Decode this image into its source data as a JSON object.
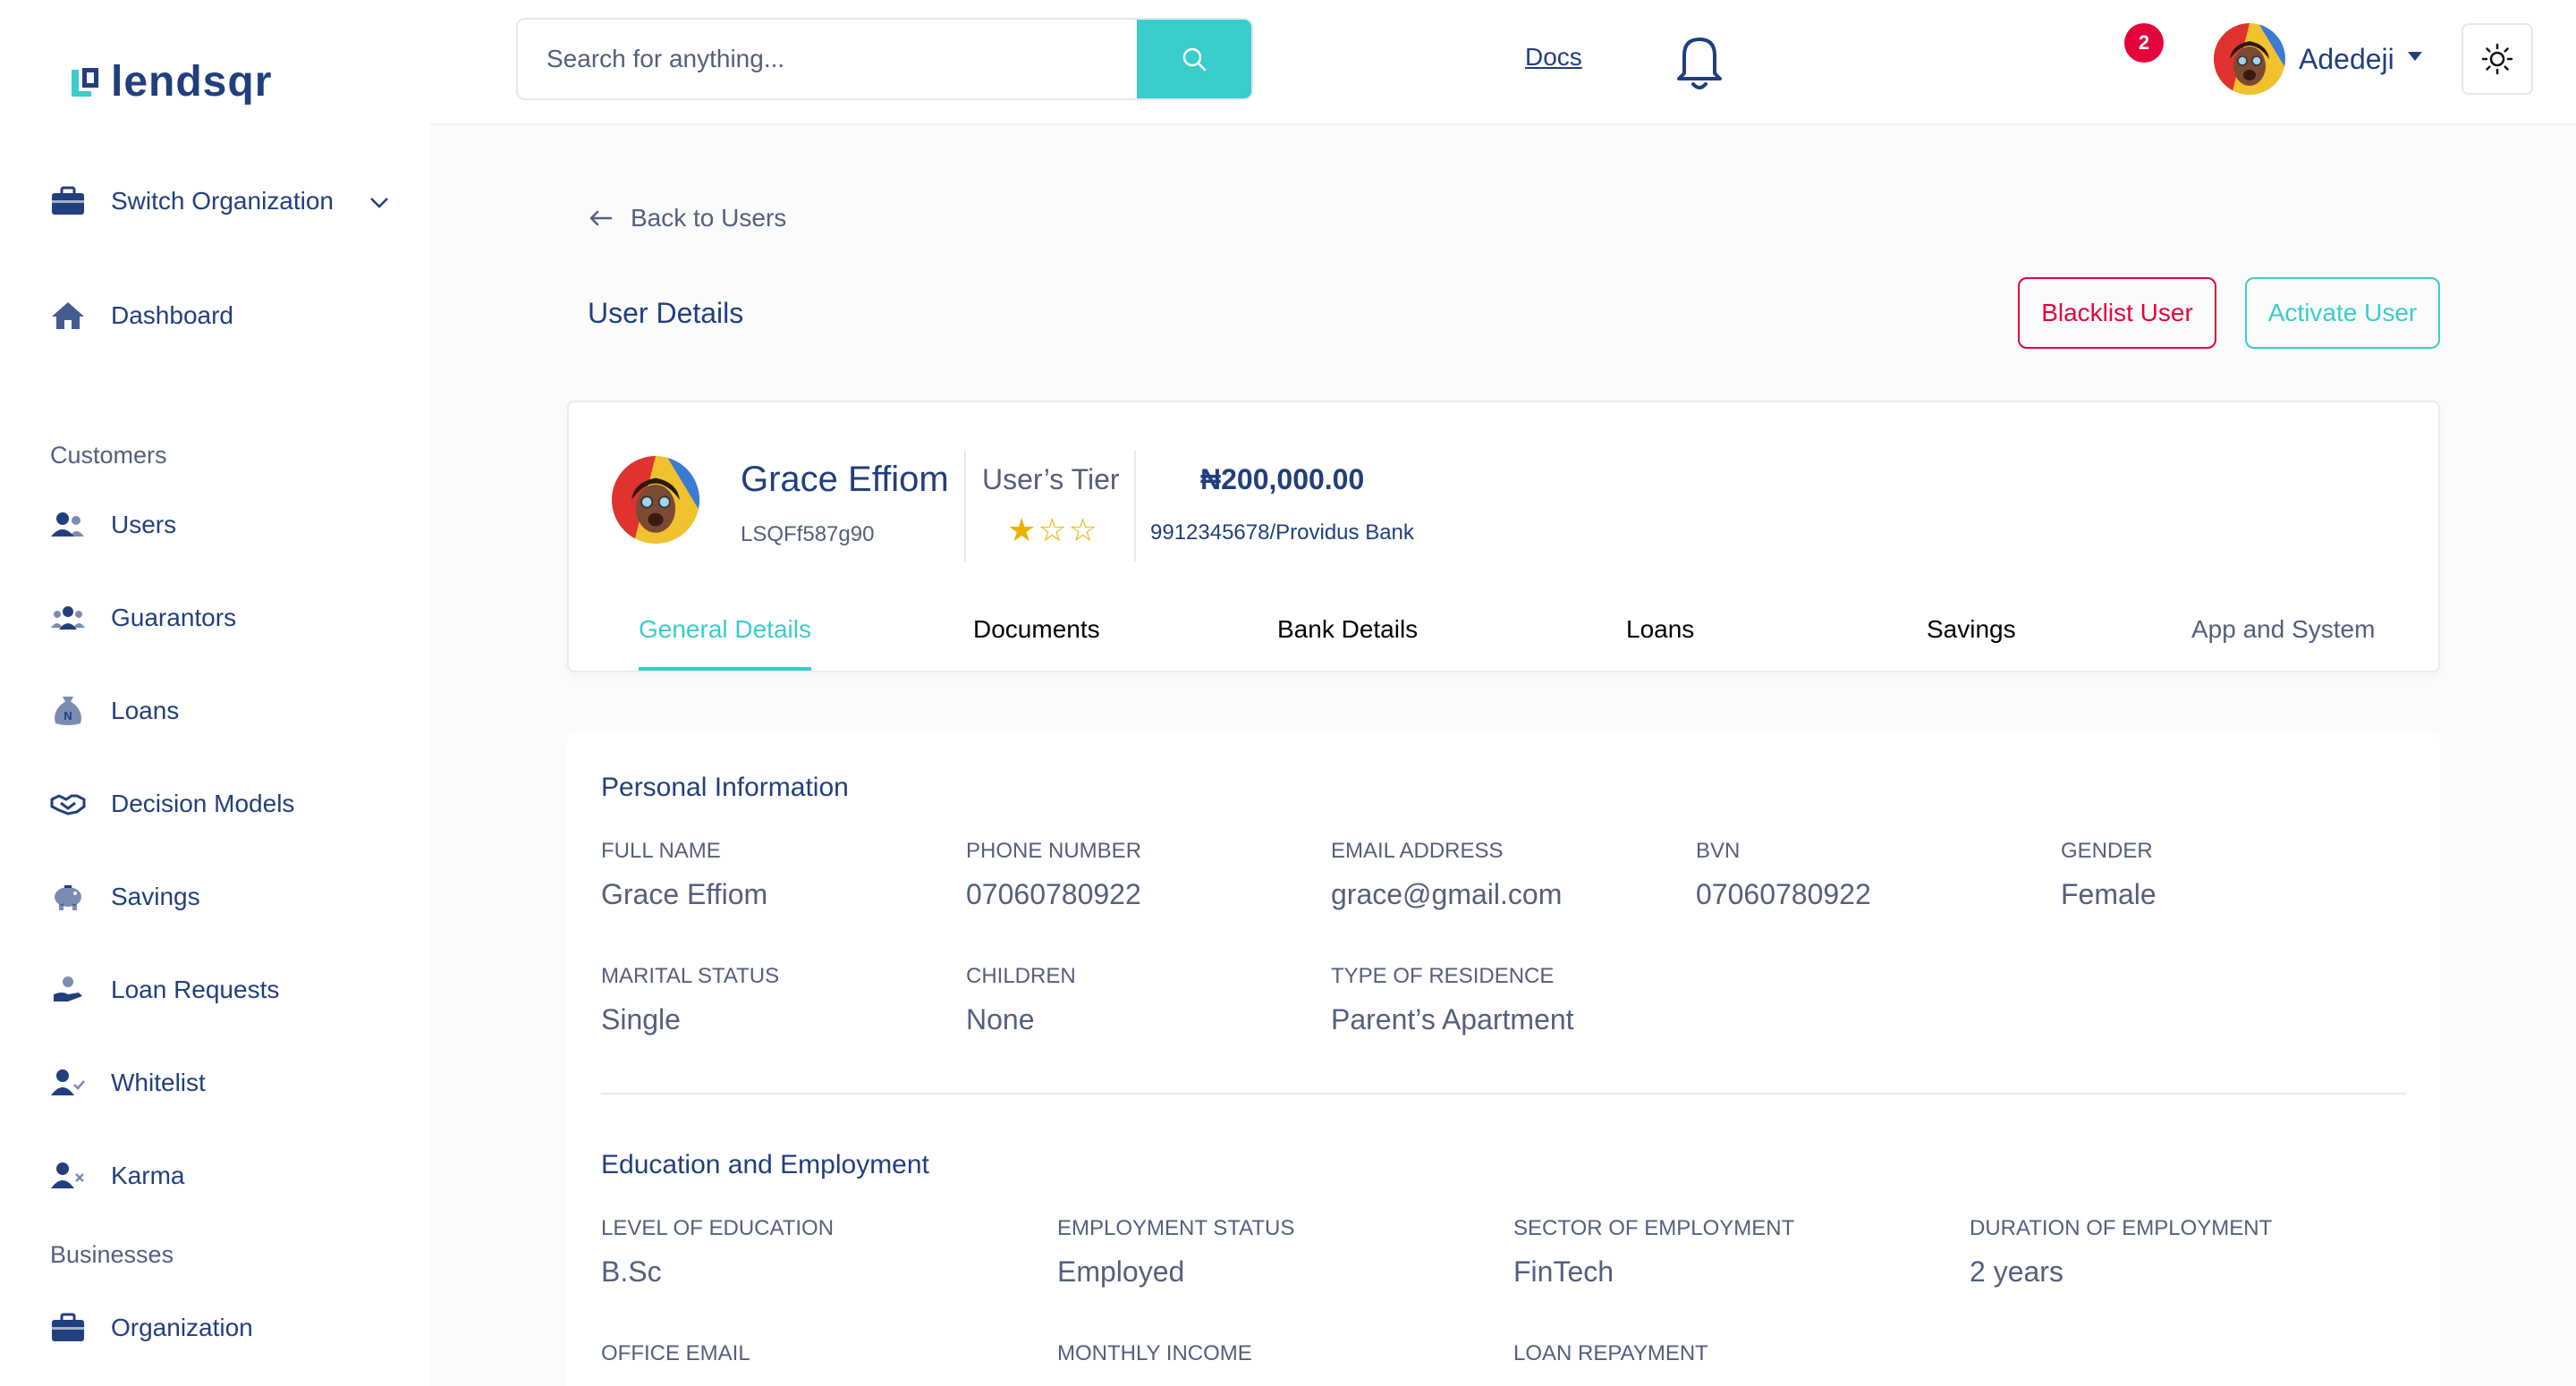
{
  "brand": {
    "name": "lendsqr"
  },
  "sidebar": {
    "switch_org": "Switch Organization",
    "dashboard": "Dashboard",
    "sections": {
      "customers": "Customers",
      "businesses": "Businesses"
    },
    "customers": [
      {
        "label": "Users",
        "icon": "users-icon"
      },
      {
        "label": "Guarantors",
        "icon": "guarantors-icon"
      },
      {
        "label": "Loans",
        "icon": "loan-sack-icon"
      },
      {
        "label": "Decision Models",
        "icon": "handshake-icon"
      },
      {
        "label": "Savings",
        "icon": "piggy-bank-icon"
      },
      {
        "label": "Loan Requests",
        "icon": "loan-request-icon"
      },
      {
        "label": "Whitelist",
        "icon": "user-check-icon"
      },
      {
        "label": "Karma",
        "icon": "user-x-icon"
      }
    ],
    "businesses": [
      {
        "label": "Organization",
        "icon": "briefcase-icon"
      }
    ]
  },
  "header": {
    "search_placeholder": "Search for anything...",
    "docs": "Docs",
    "notifications_count": "2",
    "user_name": "Adedeji"
  },
  "main": {
    "back_label": "Back to Users",
    "title": "User Details",
    "blacklist_label": "Blacklist User",
    "activate_label": "Activate User"
  },
  "summary": {
    "name": "Grace Effiom",
    "user_id": "LSQFf587g90",
    "tier_label": "User’s Tier",
    "tier_stars": "★☆☆",
    "balance": "₦200,000.00",
    "bank": "9912345678/Providus Bank",
    "tabs": [
      "General Details",
      "Documents",
      "Bank Details",
      "Loans",
      "Savings",
      "App and System"
    ]
  },
  "personal": {
    "title": "Personal Information",
    "fields": [
      {
        "label": "Full Name",
        "value": "Grace Effiom"
      },
      {
        "label": "Phone Number",
        "value": "07060780922"
      },
      {
        "label": "Email Address",
        "value": "grace@gmail.com"
      },
      {
        "label": "BVN",
        "value": "07060780922"
      },
      {
        "label": "Gender",
        "value": "Female"
      },
      {
        "label": "Marital status",
        "value": "Single"
      },
      {
        "label": "Children",
        "value": "None"
      },
      {
        "label": "Type of residence",
        "value": "Parent’s Apartment"
      }
    ]
  },
  "education": {
    "title": "Education and Employment",
    "fields": [
      {
        "label": "level of education",
        "value": "B.Sc"
      },
      {
        "label": "employment status",
        "value": "Employed"
      },
      {
        "label": "sector of employment",
        "value": "FinTech"
      },
      {
        "label": "Duration of employment",
        "value": "2 years"
      },
      {
        "label": "office email",
        "value": ""
      },
      {
        "label": "Monthly income",
        "value": ""
      },
      {
        "label": "loan repayment",
        "value": ""
      }
    ]
  },
  "colors": {
    "brand_blue": "#213f7d",
    "teal": "#39cdcc",
    "red": "#e4033b",
    "star": "#e9b200"
  }
}
